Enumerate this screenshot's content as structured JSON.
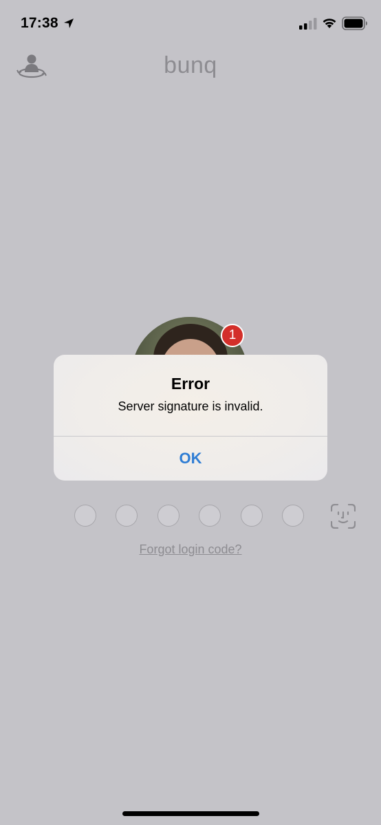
{
  "status_bar": {
    "time": "17:38",
    "icons": [
      "location-arrow-icon",
      "cellular-signal-icon",
      "wifi-icon",
      "battery-icon"
    ]
  },
  "header": {
    "brand": "bunq",
    "left_icon": "switch-user-icon"
  },
  "profile": {
    "notification_count": "1"
  },
  "alert": {
    "title": "Error",
    "message": "Server signature is invalid.",
    "ok_label": "OK",
    "ok_color": "#2f7dd4"
  },
  "login": {
    "pin_length": 6,
    "face_id_icon": "face-id-icon",
    "forgot_label": "Forgot login code?"
  },
  "colors": {
    "background": "#c4c3c8",
    "badge": "#d32f2a"
  }
}
